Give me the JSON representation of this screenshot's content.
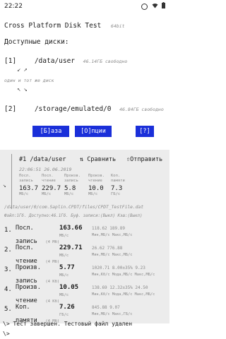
{
  "status_bar": {
    "time": "22:22",
    "icons": [
      "data-saver-icon",
      "wifi-icon",
      "battery-icon"
    ]
  },
  "app": {
    "title": "Cross Platform Disk Test",
    "subtitle": "64bit"
  },
  "disks": {
    "header": "Доступные диски:",
    "items": [
      {
        "index": "[1]",
        "path": "/data/user",
        "free": "46.14ГБ свободно"
      },
      {
        "index": "[2]",
        "path": "/storage/emulated/0",
        "free": "46.84ГБ свободно"
      }
    ],
    "same_disk_note": "один и тот же диск"
  },
  "buttons": {
    "base": "[Б]аза",
    "options": "[О]пции",
    "help": "[?]"
  },
  "summary": {
    "title": "#1 /data/user",
    "compare": "⇅ Сравнить",
    "send": "⇧Отправить",
    "datetime": "22:06:51 26.06.2019",
    "columns": [
      {
        "top": "Посл.",
        "bottom": "запись",
        "value": "163.7",
        "unit": "МБ/с"
      },
      {
        "top": "Посл.",
        "bottom": "чтение",
        "value": "229.7",
        "unit": "МБ/с"
      },
      {
        "top": "Произв.",
        "bottom": "запись",
        "value": "5.8",
        "unit": "МБ/с"
      },
      {
        "top": "Произв.",
        "bottom": "чтение",
        "value": "10.0",
        "unit": "МБ/с"
      },
      {
        "top": "Коп.",
        "bottom": "памяти",
        "value": "7.3",
        "unit": "ГБ/с"
      }
    ],
    "file_path": "/data/user/0/com.Saplin.CPDT/files/CPDT_TestFile.dat",
    "file_info": "Файл:1Гб. Доступно:46.1Гб. Буф. записи:(Выкл) Кэш:(Выкл)"
  },
  "results": [
    {
      "num": "1.",
      "label1": "Посл.",
      "label2": "запись",
      "block": "(4 Мб)",
      "value": "163.66",
      "unit": "МБ/с",
      "extra1": "118.62  189.89",
      "extra2": "Мин,МБ/с  Макс,МБ/с"
    },
    {
      "num": "2.",
      "label1": "Посл.",
      "label2": "чтение",
      "block": "(4 Мб)",
      "value": "229.71",
      "unit": "МБ/с",
      "extra1": "26.62   776.88",
      "extra2": "Мин,МБ/с  Макс,МБ/с"
    },
    {
      "num": "3.",
      "label1": "Произв.",
      "label2": "запись",
      "block": "(4 Кб)",
      "value": "5.77",
      "unit": "МБ/с",
      "extra1": "1020.71  8.00±35% 9.23",
      "extra2": "Мин,Кб/с Мода,МБ/с Макс,МБ/с"
    },
    {
      "num": "4.",
      "label1": "Произв.",
      "label2": "чтение",
      "block": "(4 Кб)",
      "value": "10.05",
      "unit": "МБ/с",
      "extra1": "138.69  12.32±35% 24.50",
      "extra2": "Мин,Кб/с Мода,МБ/с Макс,МБ/с"
    },
    {
      "num": "5.",
      "label1": "Коп.",
      "label2": "памяти",
      "block": "(4 Мб)",
      "value": "7.26",
      "unit": "ГБ/с",
      "extra1": "845.88  9.07",
      "extra2": "Мин,МБ/с  Макс,ГБ/с"
    }
  ],
  "console": {
    "line1": "\\>  Тест завершен. Тестовый файл удален",
    "line2": "\\>"
  }
}
